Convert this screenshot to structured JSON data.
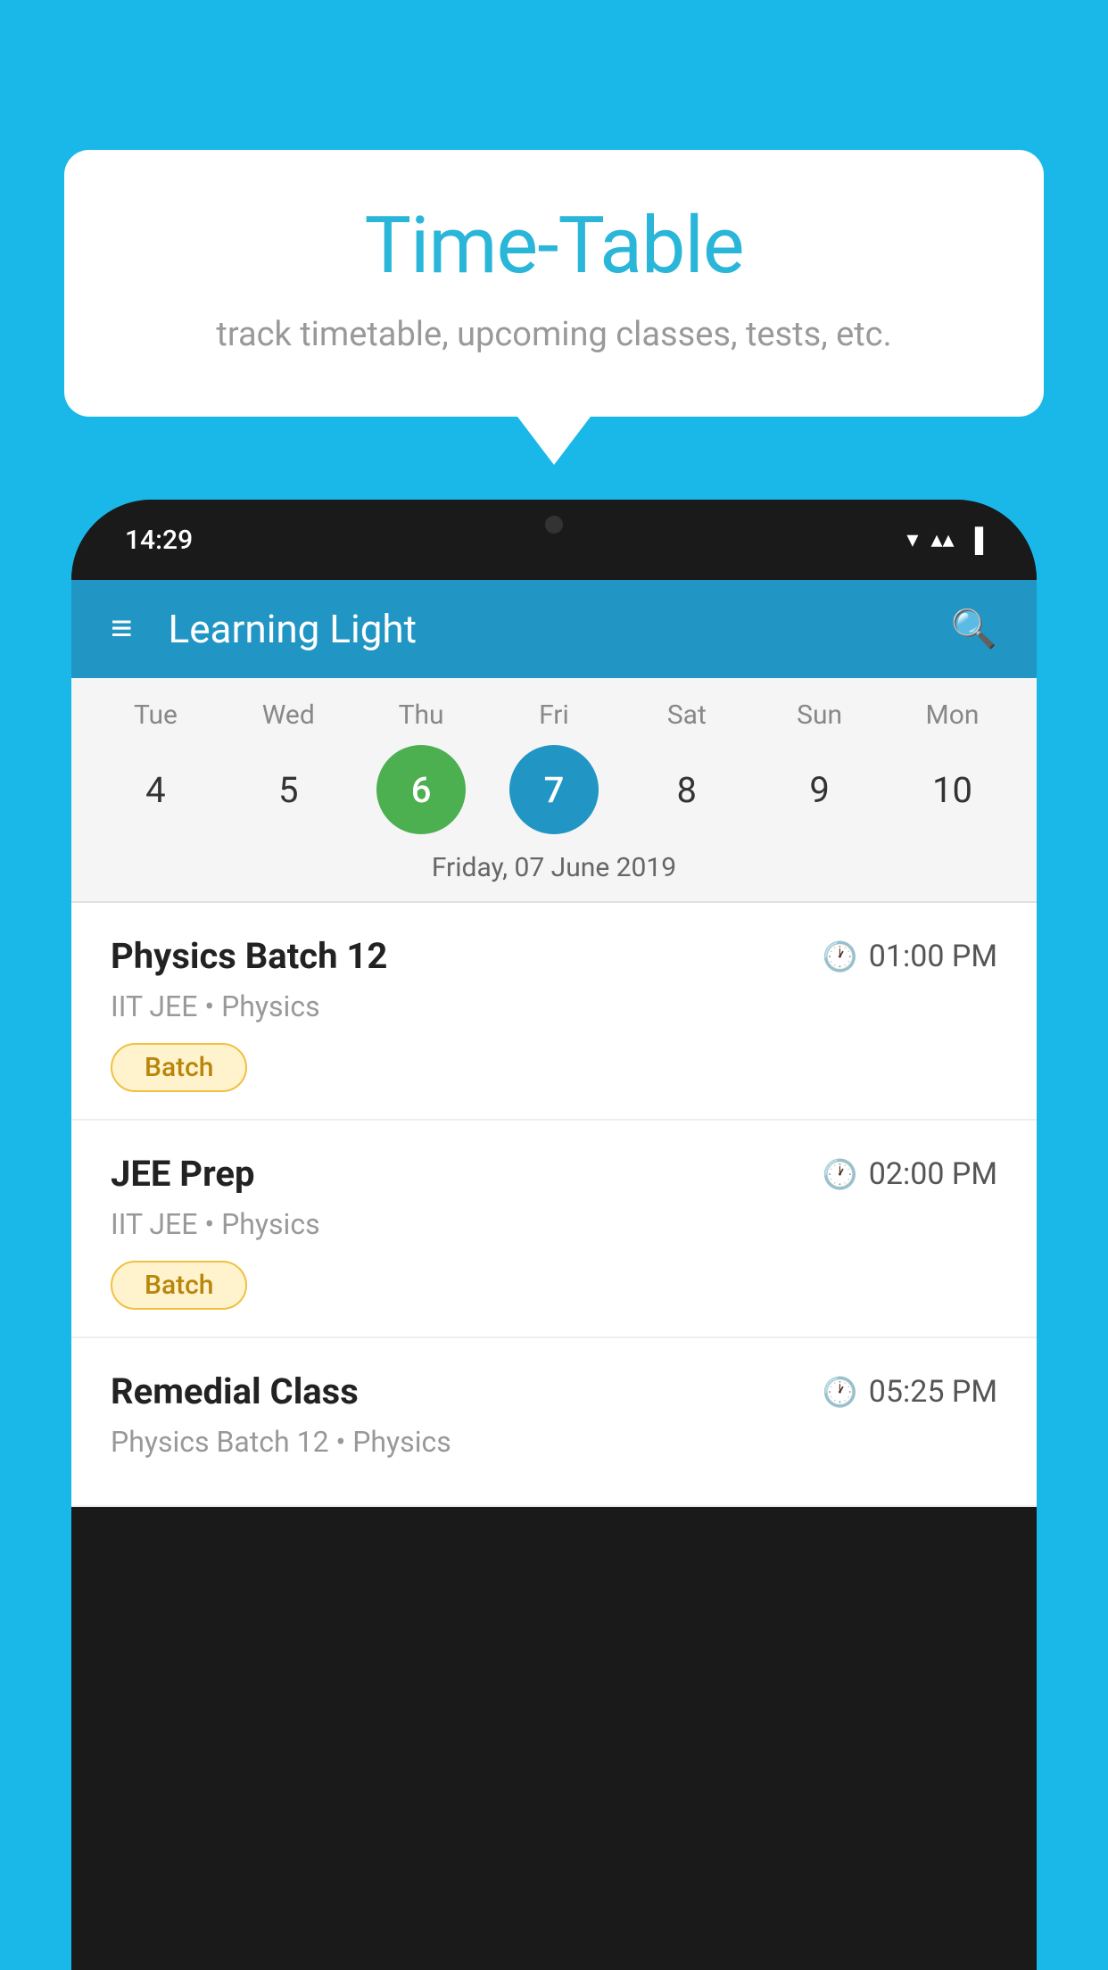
{
  "background_color": "#1ab8e8",
  "bubble": {
    "title": "Time-Table",
    "subtitle": "track timetable, upcoming classes, tests, etc."
  },
  "status_bar": {
    "time": "14:29",
    "icons": [
      "▼",
      "▲",
      "▌"
    ]
  },
  "app_bar": {
    "title": "Learning Light",
    "menu_icon": "≡",
    "search_icon": "🔍"
  },
  "calendar": {
    "days": [
      {
        "label": "Tue",
        "num": "4",
        "state": "normal"
      },
      {
        "label": "Wed",
        "num": "5",
        "state": "normal"
      },
      {
        "label": "Thu",
        "num": "6",
        "state": "today"
      },
      {
        "label": "Fri",
        "num": "7",
        "state": "selected"
      },
      {
        "label": "Sat",
        "num": "8",
        "state": "normal"
      },
      {
        "label": "Sun",
        "num": "9",
        "state": "normal"
      },
      {
        "label": "Mon",
        "num": "10",
        "state": "normal"
      }
    ],
    "selected_date": "Friday, 07 June 2019"
  },
  "schedule_items": [
    {
      "title": "Physics Batch 12",
      "time": "01:00 PM",
      "subtitle": "IIT JEE • Physics",
      "tag": "Batch"
    },
    {
      "title": "JEE Prep",
      "time": "02:00 PM",
      "subtitle": "IIT JEE • Physics",
      "tag": "Batch"
    },
    {
      "title": "Remedial Class",
      "time": "05:25 PM",
      "subtitle": "Physics Batch 12 • Physics",
      "tag": null
    }
  ]
}
